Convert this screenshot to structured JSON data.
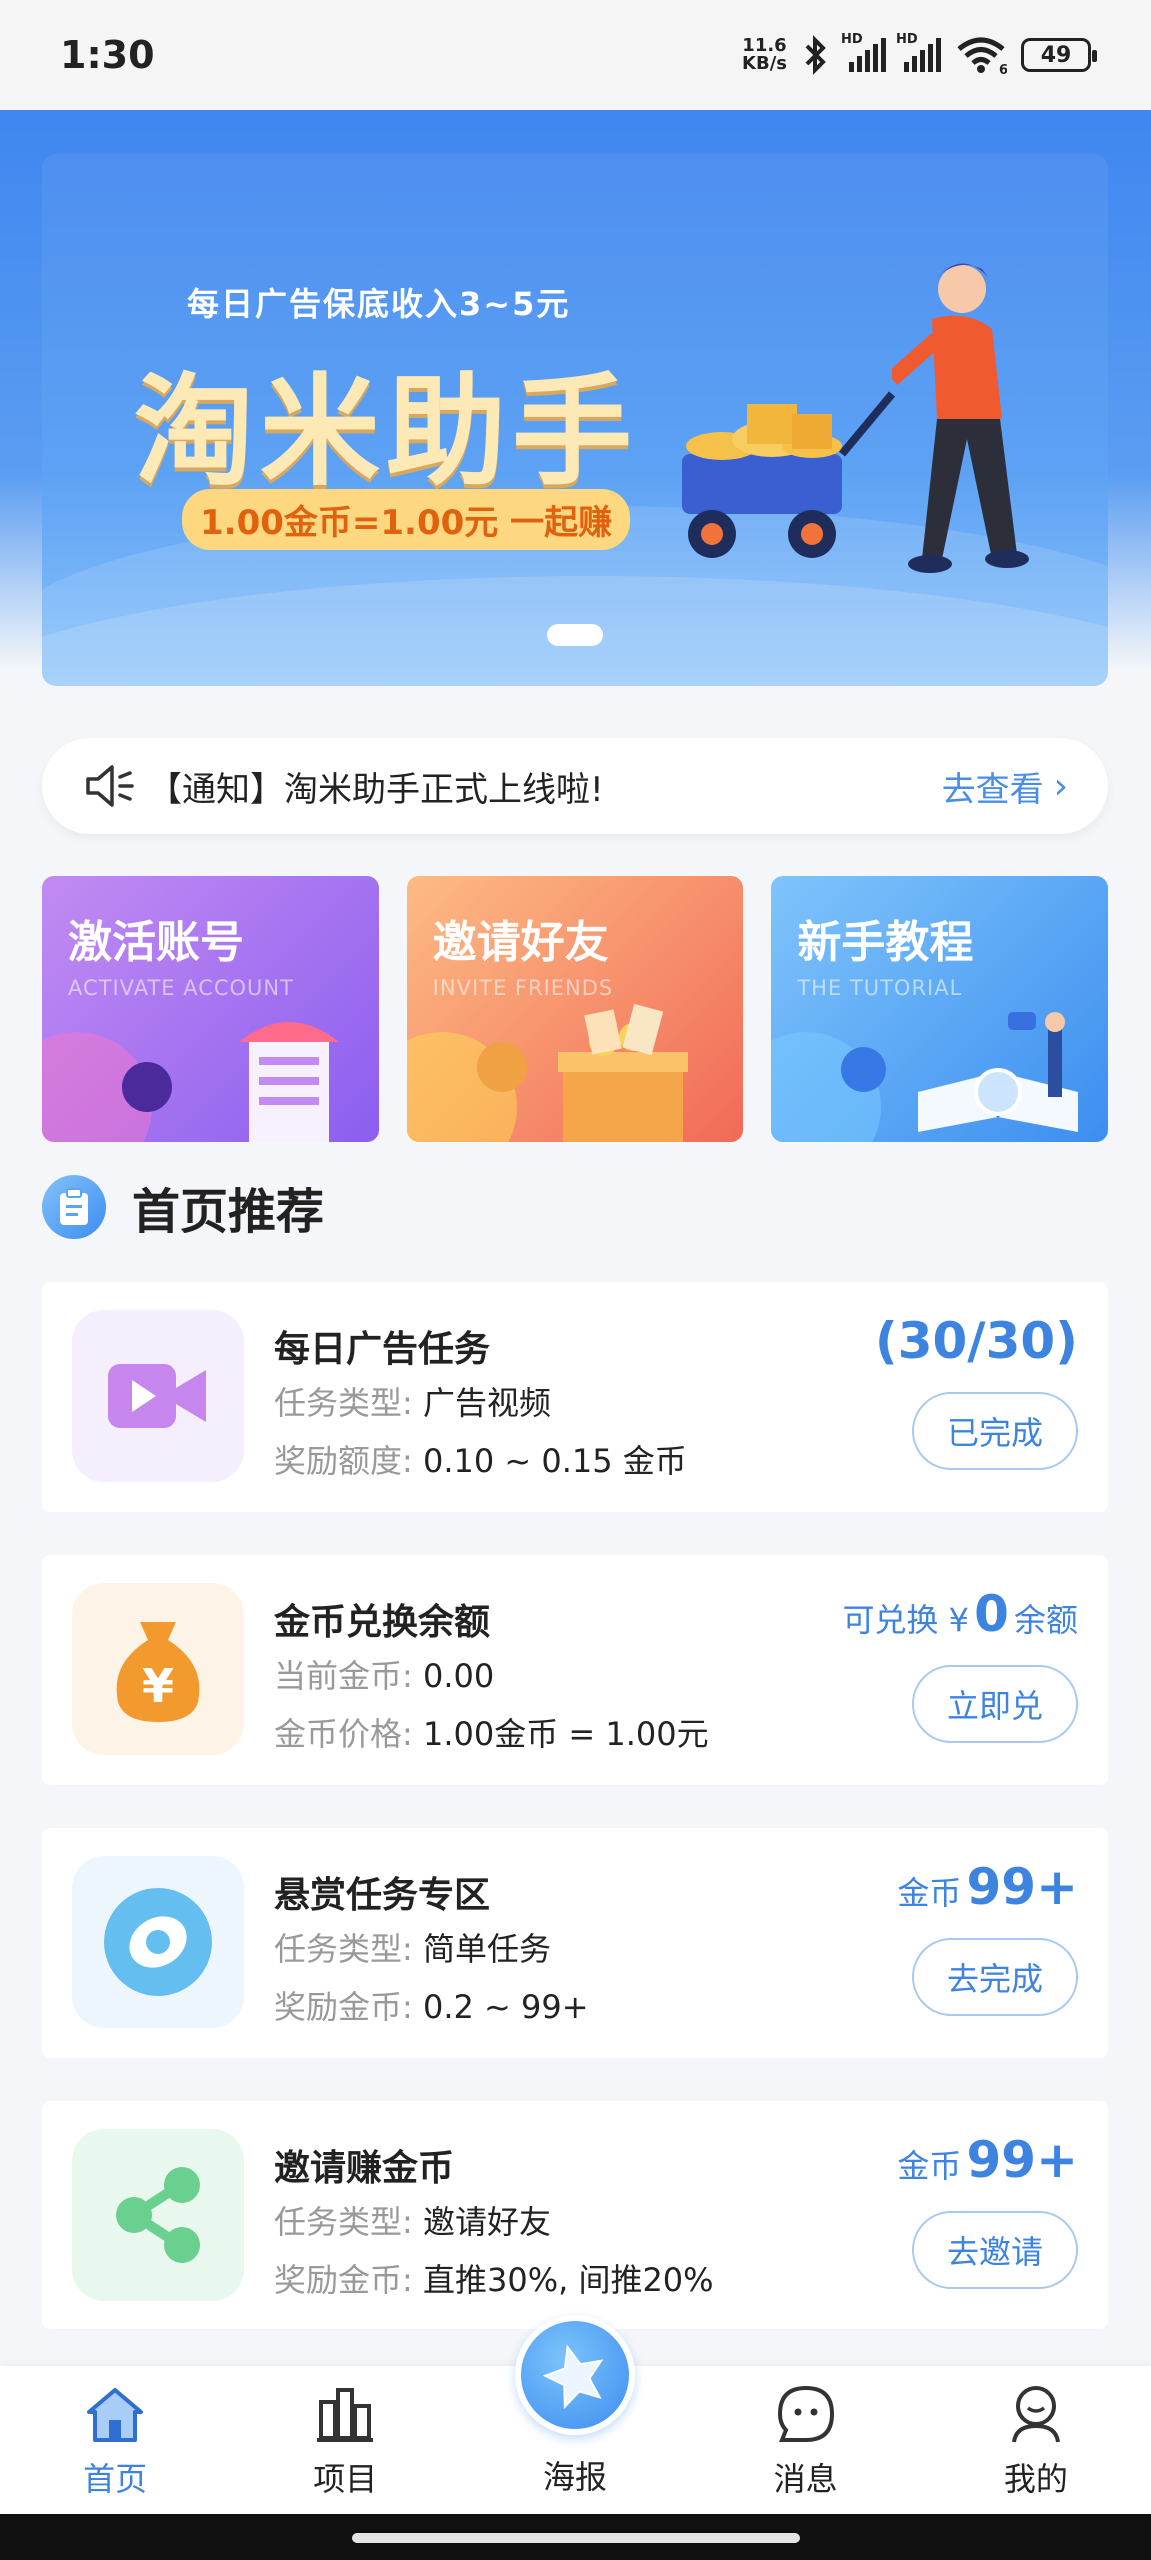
{
  "status_bar": {
    "time": "1:30",
    "net_speed_value": "11.6",
    "net_speed_unit": "KB/s",
    "hd1": "HD",
    "hd2": "HD",
    "wifi_badge": "6",
    "battery": "49"
  },
  "banner": {
    "subtitle": "每日广告保底收入3~5元",
    "title": "淘米助手",
    "pill": "1.00金币=1.00元 一起赚"
  },
  "notice": {
    "text": "【通知】淘米助手正式上线啦!",
    "link": "去查看"
  },
  "features": [
    {
      "title": "激活账号",
      "subtitle": "ACTIVATE ACCOUNT"
    },
    {
      "title": "邀请好友",
      "subtitle": "INVITE FRIENDS"
    },
    {
      "title": "新手教程",
      "subtitle": "THE TUTORIAL"
    }
  ],
  "section": {
    "title": "首页推荐"
  },
  "tasks": [
    {
      "name": "每日广告任务",
      "line1_key": "任务类型:",
      "line1_val": "广告视频",
      "line2_key": "奖励额度:",
      "line2_val": "0.10 ~ 0.15 金币",
      "stat": "(30/30)",
      "button": "已完成"
    },
    {
      "name": "金币兑换余额",
      "line1_key": "当前金币:",
      "line1_val": "0.00",
      "line2_key": "金币价格:",
      "line2_val": "1.00金币 = 1.00元",
      "stat_prefix": "可兑换 ¥",
      "stat": "0",
      "stat_suffix": "余额",
      "button": "立即兑"
    },
    {
      "name": "悬赏任务专区",
      "line1_key": "任务类型:",
      "line1_val": "简单任务",
      "line2_key": "奖励金币:",
      "line2_val": "0.2 ~ 99+",
      "stat_prefix": "金币",
      "stat": "99+",
      "button": "去完成"
    },
    {
      "name": "邀请赚金币",
      "line1_key": "任务类型:",
      "line1_val": "邀请好友",
      "line2_key": "奖励金币:",
      "line2_val": "直推30%, 间推20%",
      "stat_prefix": "金币",
      "stat": "99+",
      "button": "去邀请"
    }
  ],
  "bottom_nav": {
    "items": [
      {
        "label": "首页",
        "icon": "home-icon",
        "active": true
      },
      {
        "label": "项目",
        "icon": "project-icon"
      },
      {
        "label": "消息",
        "icon": "message-icon"
      },
      {
        "label": "我的",
        "icon": "profile-icon"
      }
    ],
    "center": {
      "label": "海报",
      "icon": "poster-star-icon"
    }
  },
  "colors": {
    "primary": "#3d83e0",
    "banner_title": "#fde9b6",
    "pill_bg": "#fdd880",
    "pill_text": "#e0620f"
  }
}
